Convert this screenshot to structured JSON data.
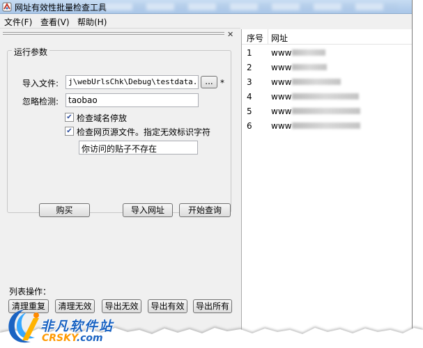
{
  "window": {
    "title": "网址有效性批量检查工具"
  },
  "menu": {
    "items": [
      "文件(F)",
      "查看(V)",
      "帮助(H)"
    ]
  },
  "params": {
    "group_title": "运行参数",
    "import_label": "导入文件:",
    "import_value": "j\\webUrlsChk\\Debug\\testdata.txt",
    "browse_label": "...",
    "required_mark": "*",
    "ignore_label": "忽略检测:",
    "ignore_value": "taobao",
    "check_domain_label": "检查域名停放",
    "check_domain_checked": true,
    "check_source_label": "检查网页源文件。指定无效标识字符",
    "check_source_checked": true,
    "invalid_marker_value": "你访问的贴子不存在"
  },
  "buttons": {
    "buy": "购买",
    "import_urls": "导入网址",
    "start_query": "开始查询"
  },
  "list_ops": {
    "label": "列表操作：",
    "clear_duplicates": "清理重复",
    "clear_invalid": "清理无效",
    "export_invalid": "导出无效",
    "export_valid": "导出有效",
    "export_all": "导出所有"
  },
  "results": {
    "columns": {
      "index": "序号",
      "url": "网址"
    },
    "rows": [
      {
        "index": "1",
        "url": "www"
      },
      {
        "index": "2",
        "url": "www"
      },
      {
        "index": "3",
        "url": "www"
      },
      {
        "index": "4",
        "url": "www"
      },
      {
        "index": "5",
        "url": "www"
      },
      {
        "index": "6",
        "url": "www"
      }
    ]
  },
  "watermark": {
    "brand_cn": "非凡软件站",
    "brand_en": "CRSKY",
    "brand_tld": ".com"
  }
}
